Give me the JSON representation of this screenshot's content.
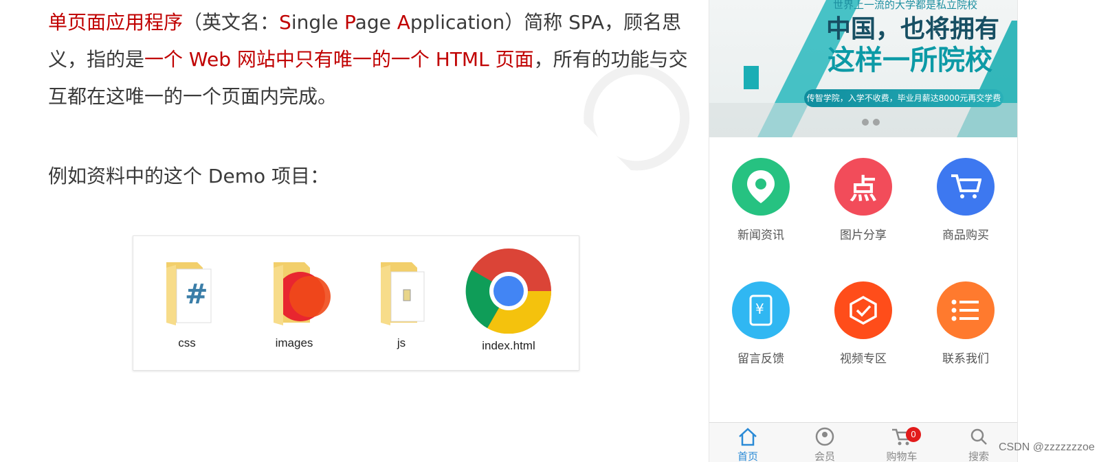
{
  "article": {
    "p1_red1": "单页面应用程序",
    "p1_mid1": "（英文名：",
    "p1_red_S": "S",
    "p1_ingle": "ingle ",
    "p1_red_P": "P",
    "p1_age": "age ",
    "p1_red_A": "A",
    "p1_pplication": "pplication",
    "p1_tail": "）简称 SPA，顾名思义，指的是",
    "p1_red2": "一个 Web 网站中只有唯一的一个 HTML 页面",
    "p1_end": "，所有的功能与交互都在这唯一的一个页面内完成。",
    "example": "例如资料中的这个 Demo 项目："
  },
  "files": [
    {
      "name": "css",
      "icon": "folder-css-icon"
    },
    {
      "name": "images",
      "icon": "folder-images-icon"
    },
    {
      "name": "js",
      "icon": "folder-js-icon"
    },
    {
      "name": "index.html",
      "icon": "chrome-icon"
    }
  ],
  "phone": {
    "banner": {
      "top_line": "世界上一流的大学都是私立院校",
      "line1": "中国，也将拥有",
      "line2": "这样一所院校",
      "pill": "传智学院，入学不收费，毕业月薪达8000元再交学费"
    },
    "grid": [
      {
        "label": "新闻资讯",
        "icon": "location-pin-icon",
        "color": "#26c281"
      },
      {
        "label": "图片分享",
        "icon": "dianping-icon",
        "color": "#f24c5a"
      },
      {
        "label": "商品购买",
        "icon": "shopping-cart-icon",
        "color": "#3d78f0"
      },
      {
        "label": "留言反馈",
        "icon": "yen-tablet-icon",
        "color": "#30b7f2"
      },
      {
        "label": "视频专区",
        "icon": "shield-check-icon",
        "color": "#ff4d1a"
      },
      {
        "label": "联系我们",
        "icon": "list-icon",
        "color": "#ff7a2e"
      }
    ],
    "tabs": [
      {
        "label": "首页",
        "icon": "home-icon",
        "active": true
      },
      {
        "label": "会员",
        "icon": "user-icon",
        "active": false
      },
      {
        "label": "购物车",
        "icon": "cart-icon",
        "active": false,
        "badge": "0"
      },
      {
        "label": "搜索",
        "icon": "search-icon",
        "active": false
      }
    ]
  },
  "footer": {
    "credit": "CSDN @zzzzzzzoe"
  },
  "colors": {
    "accent_red": "#c00000",
    "tab_active": "#2a8ad6"
  }
}
